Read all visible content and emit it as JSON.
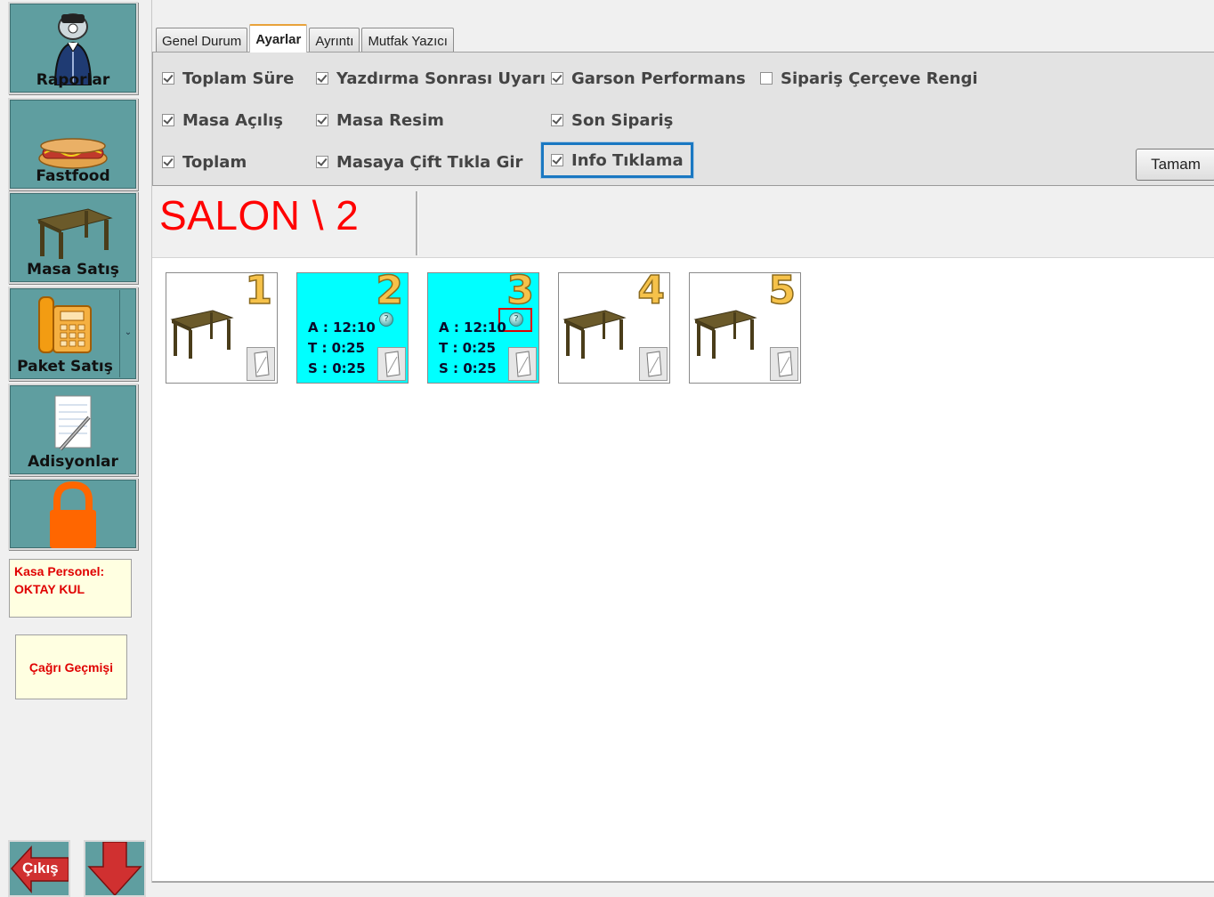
{
  "sidebar": {
    "buttons": [
      {
        "label": "Raporlar",
        "icon": "waiter-icon"
      },
      {
        "label": "Fastfood",
        "icon": "hotdog-icon"
      },
      {
        "label": "Masa Satış",
        "icon": "table-icon"
      },
      {
        "label": "Paket Satış",
        "icon": "phone-icon"
      },
      {
        "label": "Adisyonlar",
        "icon": "notepad-icon"
      },
      {
        "label": "",
        "icon": "lock-icon"
      }
    ],
    "staff_label": "Kasa Personel:",
    "staff_name": "OKTAY KUL",
    "history_label": "Çağrı Geçmişi",
    "exit_label": "Çıkış"
  },
  "tabs": [
    {
      "label": "Genel Durum",
      "active": false
    },
    {
      "label": "Ayarlar",
      "active": true
    },
    {
      "label": "Ayrıntı",
      "active": false
    },
    {
      "label": "Mutfak Yazıcı",
      "active": false
    }
  ],
  "settings": {
    "options": [
      {
        "label": "Toplam Süre",
        "checked": true
      },
      {
        "label": "Yazdırma Sonrası Uyarı",
        "checked": true
      },
      {
        "label": "Garson Performans",
        "checked": true
      },
      {
        "label": "Sipariş Çerçeve Rengi",
        "checked": false
      },
      {
        "label": "Masa Açılış",
        "checked": true
      },
      {
        "label": "Masa Resim",
        "checked": true
      },
      {
        "label": "Son Sipariş",
        "checked": true
      },
      {
        "label": "Toplam",
        "checked": true
      },
      {
        "label": "Masaya Çift Tıkla Gir",
        "checked": true
      },
      {
        "label": "Info Tıklama",
        "checked": true
      }
    ],
    "ok_label": "Tamam"
  },
  "salon": {
    "title": "SALON \\ 2"
  },
  "tables": [
    {
      "number": "1",
      "occupied": false
    },
    {
      "number": "2",
      "occupied": true,
      "line_a": "A : 12:10",
      "line_t": "T : 0:25",
      "line_s": "S : 0:25"
    },
    {
      "number": "3",
      "occupied": true,
      "line_a": "A : 12:10",
      "line_t": "T : 0:25",
      "line_s": "S : 0:25"
    },
    {
      "number": "4",
      "occupied": false
    },
    {
      "number": "5",
      "occupied": false
    }
  ],
  "colors": {
    "sidebar_button": "#5f9ea0",
    "occupied_table": "#00ffff",
    "salon_title": "#ff0000",
    "staff_text": "#e00000",
    "focus_outline": "#1a78c2",
    "highlight_box": "#e00000"
  }
}
